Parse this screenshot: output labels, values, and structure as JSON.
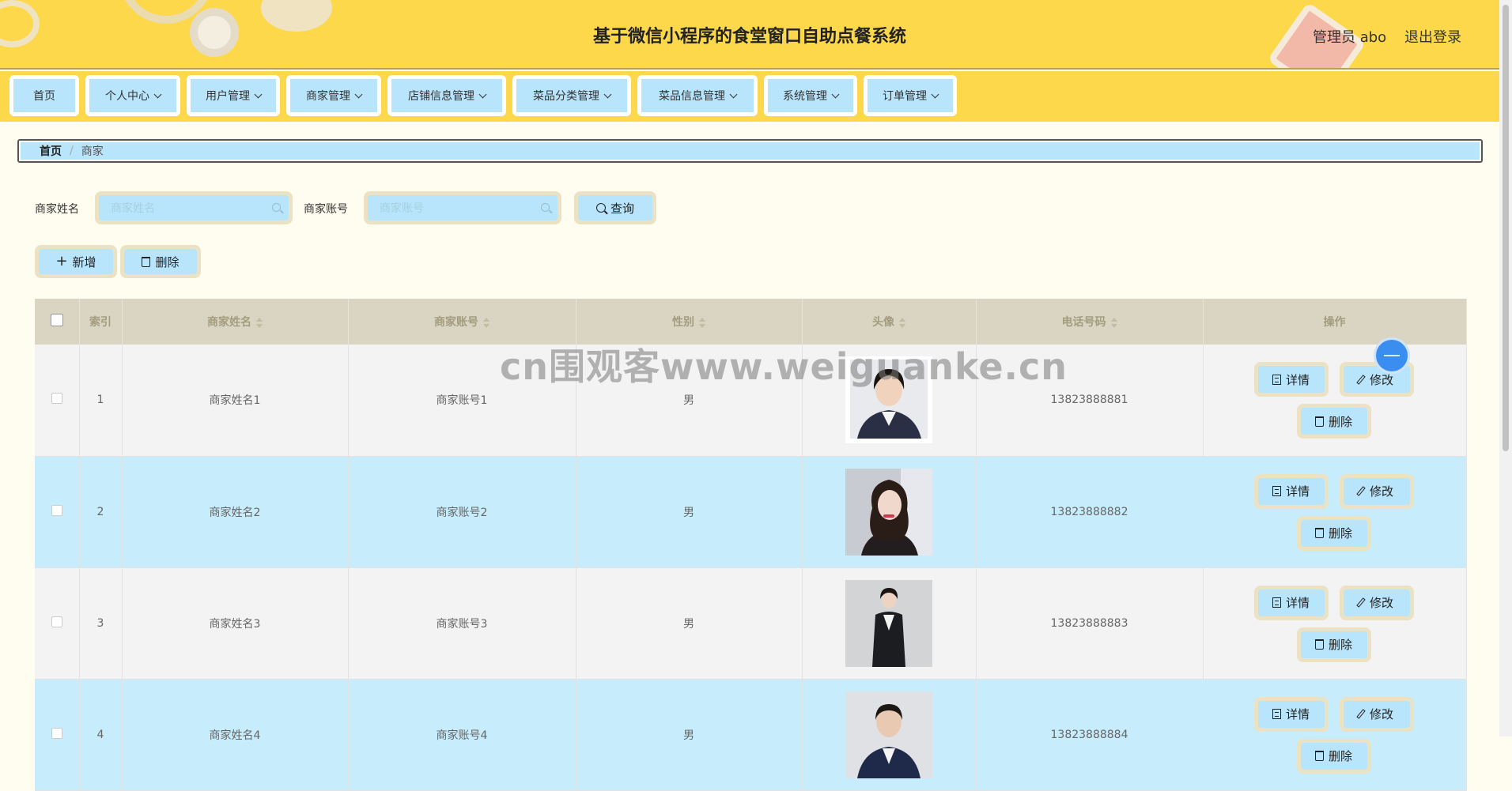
{
  "header": {
    "title": "基于微信小程序的食堂窗口自助点餐系统",
    "user_label": "管理员 abo",
    "logout_label": "退出登录"
  },
  "nav": [
    {
      "label": "首页",
      "dropdown": false
    },
    {
      "label": "个人中心",
      "dropdown": true
    },
    {
      "label": "用户管理",
      "dropdown": true
    },
    {
      "label": "商家管理",
      "dropdown": true
    },
    {
      "label": "店铺信息管理",
      "dropdown": true
    },
    {
      "label": "菜品分类管理",
      "dropdown": true
    },
    {
      "label": "菜品信息管理",
      "dropdown": true
    },
    {
      "label": "系统管理",
      "dropdown": true
    },
    {
      "label": "订单管理",
      "dropdown": true
    }
  ],
  "breadcrumb": {
    "home": "首页",
    "separator": "/",
    "current": "商家"
  },
  "search": {
    "name_label": "商家姓名",
    "name_placeholder": "商家姓名",
    "account_label": "商家账号",
    "account_placeholder": "商家账号",
    "query_label": "查询"
  },
  "actions": {
    "add_label": "新增",
    "delete_label": "删除"
  },
  "table": {
    "columns": [
      "索引",
      "商家姓名",
      "商家账号",
      "性别",
      "头像",
      "电话号码",
      "操作"
    ],
    "rows": [
      {
        "index": "1",
        "name": "商家姓名1",
        "account": "商家账号1",
        "gender": "男",
        "phone": "13823888881"
      },
      {
        "index": "2",
        "name": "商家姓名2",
        "account": "商家账号2",
        "gender": "男",
        "phone": "13823888882"
      },
      {
        "index": "3",
        "name": "商家姓名3",
        "account": "商家账号3",
        "gender": "男",
        "phone": "13823888883"
      },
      {
        "index": "4",
        "name": "商家姓名4",
        "account": "商家账号4",
        "gender": "男",
        "phone": "13823888884"
      }
    ],
    "row_buttons": {
      "detail": "详情",
      "edit": "修改",
      "delete": "删除"
    }
  },
  "watermark": "cn围观客www.weiguanke.cn",
  "colors": {
    "header_bg": "#fcd84a",
    "button_bg": "#b8e5fb",
    "row_alt": "#c7ecfb",
    "table_head": "#d9d5c2"
  }
}
